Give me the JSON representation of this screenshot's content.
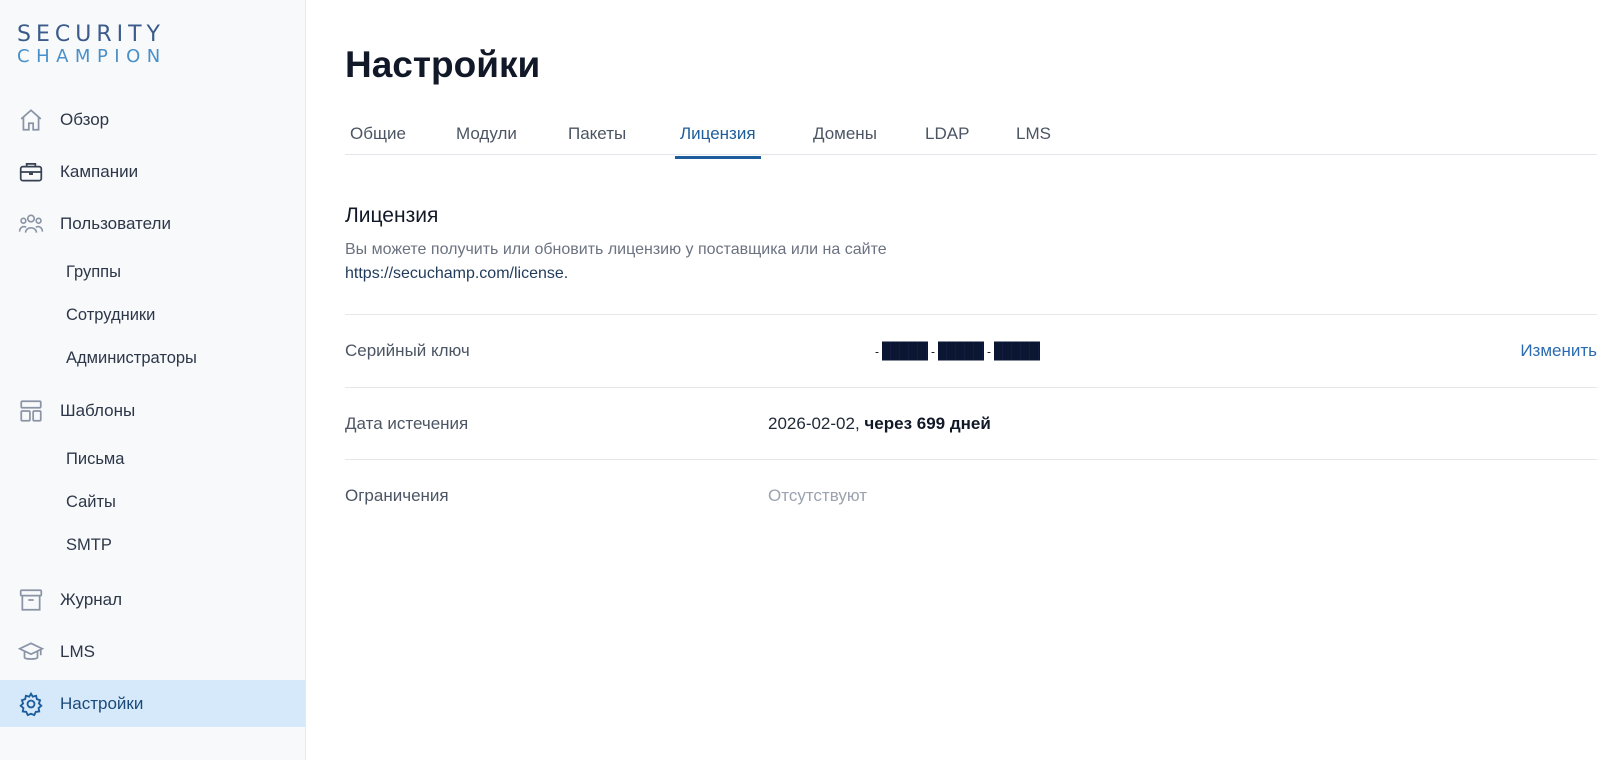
{
  "logo": {
    "line1": "SECURITY",
    "line2": "CHAMPION"
  },
  "sidebar": {
    "items": [
      {
        "label": "Обзор",
        "icon": "home-icon"
      },
      {
        "label": "Кампании",
        "icon": "briefcase-icon"
      },
      {
        "label": "Пользователи",
        "icon": "users-icon"
      },
      {
        "label": "Группы"
      },
      {
        "label": "Сотрудники"
      },
      {
        "label": "Администраторы"
      },
      {
        "label": "Шаблоны",
        "icon": "layout-icon"
      },
      {
        "label": "Письма"
      },
      {
        "label": "Сайты"
      },
      {
        "label": "SMTP"
      },
      {
        "label": "Журнал",
        "icon": "archive-icon"
      },
      {
        "label": "LMS",
        "icon": "graduation-cap-icon"
      },
      {
        "label": "Настройки",
        "icon": "gear-icon"
      }
    ],
    "active": "Настройки"
  },
  "main": {
    "title": "Настройки",
    "tabs": [
      {
        "label": "Общие"
      },
      {
        "label": "Модули"
      },
      {
        "label": "Пакеты"
      },
      {
        "label": "Лицензия"
      },
      {
        "label": "Домены"
      },
      {
        "label": "LDAP"
      },
      {
        "label": "LMS"
      }
    ],
    "active_tab": "Лицензия",
    "license": {
      "title": "Лицензия",
      "description": "Вы можете получить или обновить лицензию у поставщика или на сайте",
      "link": "https://secuchamp.com/license.",
      "rows": [
        {
          "key": "Серийный ключ",
          "value": "-████-████-████",
          "action": "Изменить"
        },
        {
          "key": "Дата истечения",
          "value_date": "2026-02-02,",
          "value_rel": "через 699 дней"
        },
        {
          "key": "Ограничения",
          "value": "Отсутствуют"
        }
      ]
    }
  },
  "colors": {
    "accent": "#1d5d9b",
    "active_bg": "#d6e9fa",
    "link": "#2b6cb0"
  }
}
